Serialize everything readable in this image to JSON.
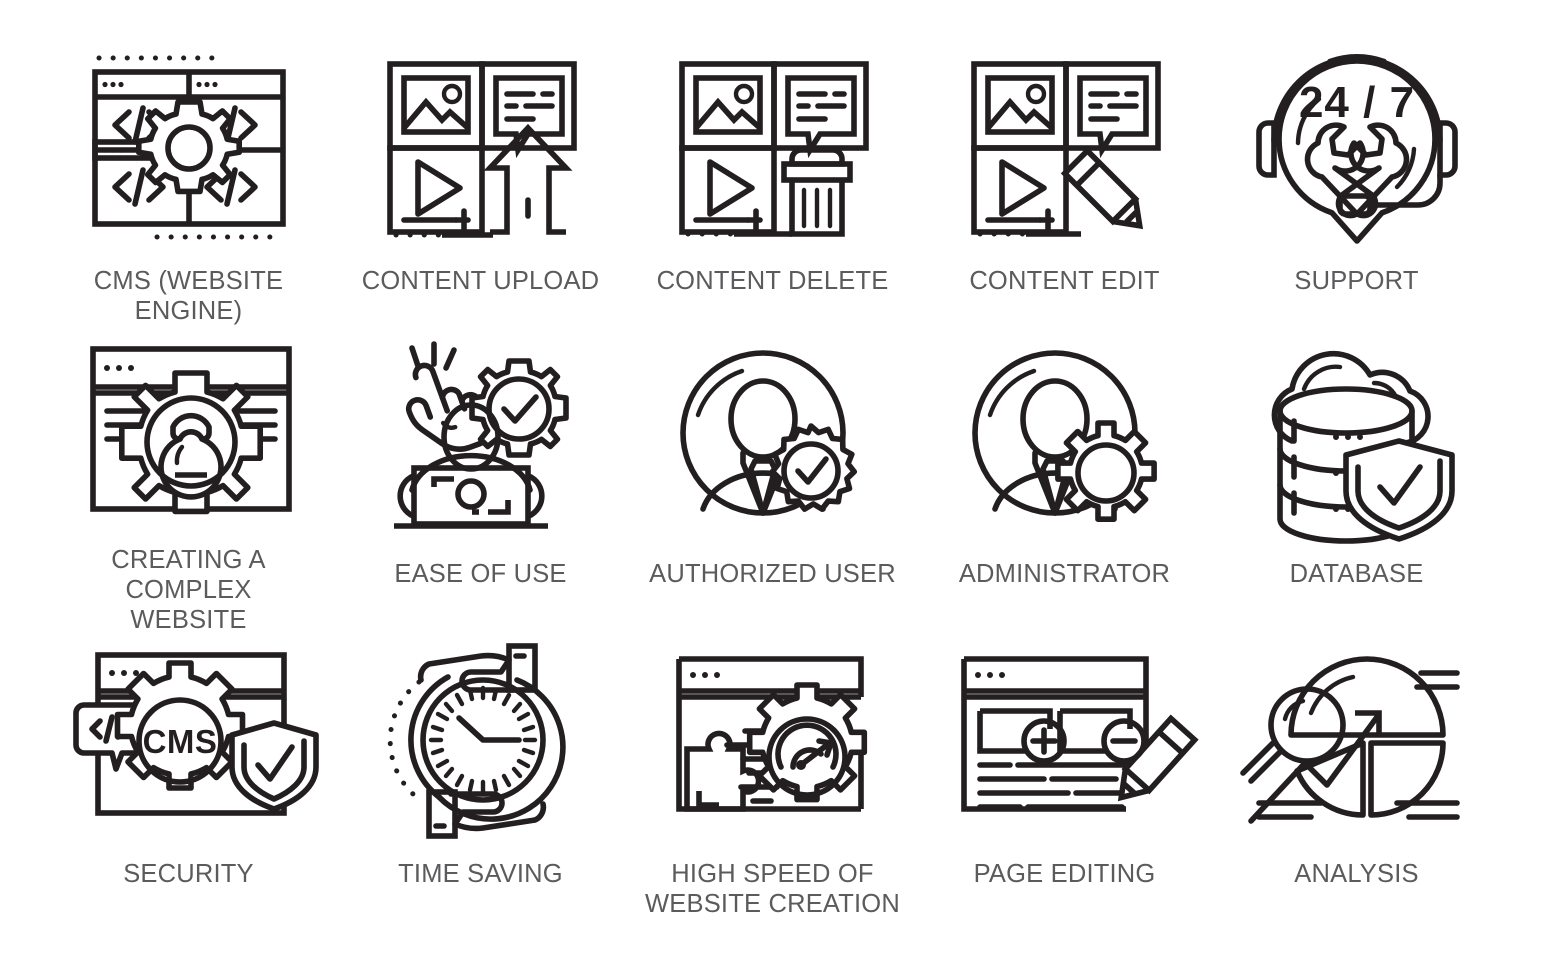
{
  "page": {
    "title": "CMS line icon set",
    "background_color": "#ffffff",
    "line_color": "#231f20",
    "label_color": "#5b5b5d",
    "columns": 5,
    "rows": 3
  },
  "icons": [
    {
      "id": "cms-website-engine",
      "label": "CMS (WEBSITE ENGINE)",
      "icon_name": "cms-website-engine-icon",
      "row": 1,
      "col": 1,
      "elements": [
        "browser-window",
        "code-brackets",
        "gear",
        "dotted-border"
      ],
      "inner_text": []
    },
    {
      "id": "content-upload",
      "label": "CONTENT UPLOAD",
      "icon_name": "content-upload-icon",
      "row": 1,
      "col": 2,
      "elements": [
        "image-tile",
        "chat-bubble-tile",
        "video-play-tile",
        "upload-arrow",
        "dotted-line"
      ],
      "inner_text": []
    },
    {
      "id": "content-delete",
      "label": "CONTENT DELETE",
      "icon_name": "content-delete-icon",
      "row": 1,
      "col": 3,
      "elements": [
        "image-tile",
        "chat-bubble-tile",
        "video-play-tile",
        "trash-bin",
        "dotted-line"
      ],
      "inner_text": []
    },
    {
      "id": "content-edit",
      "label": "CONTENT EDIT",
      "icon_name": "content-edit-icon",
      "row": 1,
      "col": 4,
      "elements": [
        "image-tile",
        "chat-bubble-tile",
        "video-play-tile",
        "pencil",
        "dotted-line"
      ],
      "inner_text": []
    },
    {
      "id": "support",
      "label": "SUPPORT",
      "icon_name": "support-headset-icon",
      "row": 1,
      "col": 5,
      "elements": [
        "headset",
        "map-pin",
        "crossed-wrenches",
        "microphone"
      ],
      "inner_text": [
        "24 / 7"
      ]
    },
    {
      "id": "creating-a-complex-website",
      "label": "CREATING A COMPLEX\nWEBSITE",
      "icon_name": "complex-website-icon",
      "row": 2,
      "col": 1,
      "elements": [
        "browser-window",
        "gear",
        "kettlebell",
        "text-lines"
      ],
      "inner_text": []
    },
    {
      "id": "ease-of-use",
      "label": "EASE OF USE",
      "icon_name": "ease-of-use-icon",
      "row": 2,
      "col": 2,
      "elements": [
        "pointing-hand",
        "person",
        "laptop",
        "gear-check"
      ],
      "inner_text": []
    },
    {
      "id": "authorized-user",
      "label": "AUTHORIZED USER",
      "icon_name": "authorized-user-icon",
      "row": 2,
      "col": 3,
      "elements": [
        "avatar-circle",
        "person-suit",
        "badge-check"
      ],
      "inner_text": []
    },
    {
      "id": "administrator",
      "label": "ADMINISTRATOR",
      "icon_name": "administrator-icon",
      "row": 2,
      "col": 4,
      "elements": [
        "avatar-circle",
        "person-suit",
        "gear"
      ],
      "inner_text": []
    },
    {
      "id": "database",
      "label": "DATABASE",
      "icon_name": "database-icon",
      "row": 2,
      "col": 5,
      "elements": [
        "cloud",
        "database-cylinder",
        "shield-check"
      ],
      "inner_text": []
    },
    {
      "id": "security",
      "label": "SECURITY",
      "icon_name": "security-icon",
      "row": 3,
      "col": 1,
      "elements": [
        "browser-window",
        "code-bubble",
        "gear",
        "shield-check"
      ],
      "inner_text": [
        "CMS"
      ]
    },
    {
      "id": "time-saving",
      "label": "TIME SAVING",
      "icon_name": "time-saving-icon",
      "row": 3,
      "col": 2,
      "elements": [
        "hand-top",
        "hand-bottom",
        "clock",
        "dotted-arc"
      ],
      "inner_text": []
    },
    {
      "id": "high-speed-of-website-creation",
      "label": "HIGH SPEED OF\nWEBSITE CREATION",
      "icon_name": "high-speed-creation-icon",
      "row": 3,
      "col": 3,
      "elements": [
        "browser-window",
        "speed-gauge-gear",
        "puzzle-piece",
        "speed-lines"
      ],
      "inner_text": []
    },
    {
      "id": "page-editing",
      "label": "PAGE EDITING",
      "icon_name": "page-editing-icon",
      "row": 3,
      "col": 4,
      "elements": [
        "browser-window",
        "plus-button",
        "minus-button",
        "text-lines",
        "pencil"
      ],
      "inner_text": []
    },
    {
      "id": "analysis",
      "label": "ANALYSIS",
      "icon_name": "analysis-icon",
      "row": 3,
      "col": 5,
      "elements": [
        "pie-chart",
        "magnifier",
        "leader-lines"
      ],
      "inner_text": []
    }
  ]
}
